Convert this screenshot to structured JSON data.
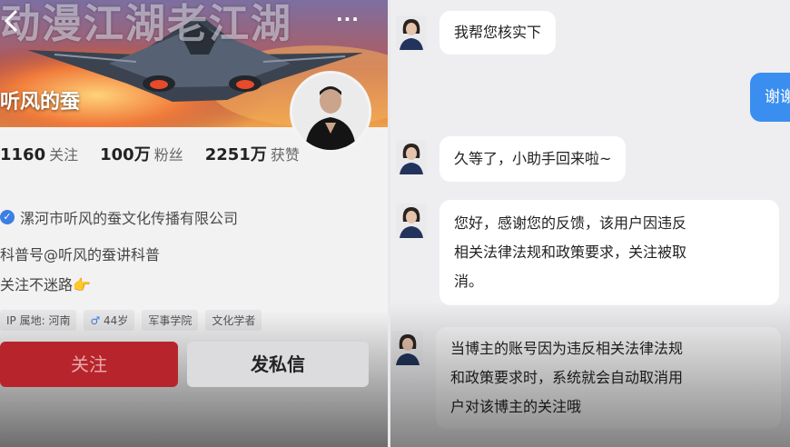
{
  "profile": {
    "banner_text": "动漫江湖老江湖",
    "username": "听风的蚕",
    "stats": [
      {
        "value": "1160",
        "label": "关注"
      },
      {
        "value": "100万",
        "label": "粉丝"
      },
      {
        "value": "2251万",
        "label": "获赞"
      }
    ],
    "company": "漯河市听风的蚕文化传播有限公司",
    "bio_line1": "科普号@听风的蚕讲科普",
    "bio_line2": "关注不迷路",
    "tags": [
      "IP 属地: 河南",
      "44岁",
      "军事学院",
      "文化学者"
    ],
    "follow_label": "关注",
    "dm_label": "发私信",
    "more_label": "...",
    "colors": {
      "follow": "#b8242c",
      "verify": "#3b7fe3"
    }
  },
  "chat": {
    "messages": [
      {
        "from": "agent",
        "text": "我帮您核实下"
      },
      {
        "from": "user",
        "text": "谢谢"
      },
      {
        "from": "agent",
        "text": "久等了，小助手回来啦~"
      },
      {
        "from": "agent",
        "lines": [
          "您好，感谢您的反馈，该用户因违反",
          "相关法律法规和政策要求，关注被取",
          "消。"
        ]
      },
      {
        "from": "agent",
        "lines": [
          "当博主的账号因为违反相关法律法规",
          "和政策要求时，系统就会自动取消用",
          "户对该博主的关注哦"
        ]
      }
    ],
    "colors": {
      "user_bubble": "#3a8ef0"
    }
  }
}
